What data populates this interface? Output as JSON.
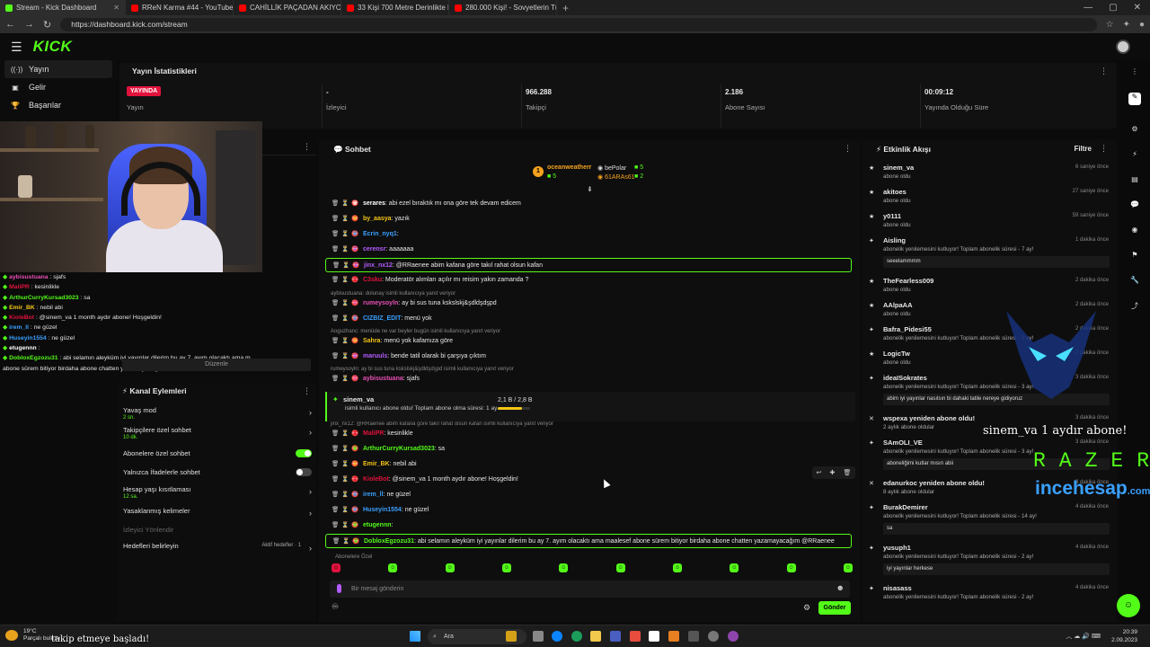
{
  "browser": {
    "tabs": [
      {
        "title": "Stream - Kick Dashboard",
        "active": true
      },
      {
        "title": "RReN Karma #44 - YouTube",
        "active": false
      },
      {
        "title": "CAHİLLİK PAÇADAN AKIYOR | 55...",
        "active": false
      },
      {
        "title": "33 Kişi 700 Metre Derinlikte Nasıl...",
        "active": false
      },
      {
        "title": "280.000 Kişi! - Sovyetlerin Tüm D...",
        "active": false
      }
    ],
    "url": "https://dashboard.kick.com/stream"
  },
  "app": {
    "logo": "KICK"
  },
  "nav": {
    "items": [
      {
        "label": "Yayın",
        "icon": "stream-icon"
      },
      {
        "label": "Gelir",
        "icon": "money-icon"
      },
      {
        "label": "Başarılar",
        "icon": "trophy-icon"
      }
    ]
  },
  "stats": {
    "title": "Yayın İstatistikleri",
    "items": [
      {
        "value": "YAYINDA",
        "label": "Yayın"
      },
      {
        "value": "-",
        "label": "İzleyici"
      },
      {
        "value": "966.288",
        "label": "Takipçi"
      },
      {
        "value": "2.186",
        "label": "Abone Sayısı"
      },
      {
        "value": "00:09:12",
        "label": "Yayında Olduğu Süre"
      }
    ]
  },
  "left_chat": [
    {
      "user": "aybisustuana",
      "text": " : sjafs",
      "color": "#e94fb5"
    },
    {
      "user": "MaliPR",
      "text": " : kesinlikle",
      "color": "#e1123c"
    },
    {
      "user": "ArthurCurryKursad3023",
      "text": " : sa",
      "color": "#53fc18"
    },
    {
      "user": "Emir_BK",
      "text": " : nebil abi",
      "color": "#f5c518"
    },
    {
      "user": "KioleBot",
      "text": " : @sinem_va 1 month aydır abone! Hoşgeldin!",
      "color": "#e1123c"
    },
    {
      "user": "irem_ll",
      "text": " : ne güzel",
      "color": "#3aa0ff"
    },
    {
      "user": "Huseyin1554",
      "text": " : ne güzel",
      "color": "#3aa0ff"
    },
    {
      "user": "etugennn",
      "text": " : ",
      "color": "#ffffff"
    },
    {
      "user": "DobloxEgzozu31",
      "text": " : abi selamın aleyküm iyi yayınlar dilerim bu ay 7. ayım olacaktı ama m",
      "color": "#53fc18"
    },
    {
      "user": "",
      "text": "abone sürem bitiyor birdaha abone chatten yazamayacağım @RRaenee",
      "color": "#ffffff"
    }
  ],
  "edit_button": "Düzenle",
  "channel_actions": {
    "title": "Kanal Eylemleri",
    "items": [
      {
        "label": "Yavaş mod",
        "sub": "2 sn.",
        "control": "chevron"
      },
      {
        "label": "Takipçilere özel sohbet",
        "sub": "10 dk.",
        "control": "chevron"
      },
      {
        "label": "Abonelere özel sohbet",
        "sub": "",
        "control": "toggle-on"
      },
      {
        "label": "Yalnızca İfadelerle sohbet",
        "sub": "",
        "control": "toggle-off"
      },
      {
        "label": "Hesap yaşı kısıtlaması",
        "sub": "12 sa.",
        "control": "chevron"
      },
      {
        "label": "Yasaklanmış kelimeler",
        "sub": "",
        "control": "chevron"
      },
      {
        "label": "İzleyici Yönlendir",
        "sub": "",
        "control": "none"
      },
      {
        "label": "Hedefleri belirleyin",
        "sub": "",
        "control": "chevron"
      }
    ],
    "goals_badge": "Aktif hedefler · 1"
  },
  "chat": {
    "title": "Sohbet",
    "pinned": {
      "top_user": "oceanweatherr",
      "top_count": "5",
      "rank": "1",
      "user2": "bePolar",
      "user2_count": "5",
      "user3": "61ARAs61",
      "user3_count": "2"
    },
    "messages": [
      {
        "user": "serares",
        "text": ": abi ezel bıraktık mı ona göre tek devam edicem",
        "color": "#ffffff",
        "hl": false
      },
      {
        "user": "by_aasya",
        "text": ": yazık",
        "color": "#f5c518",
        "hl": false
      },
      {
        "user": "Ecrin_nyq1",
        "text": ":",
        "color": "#3aa0ff",
        "hl": false
      },
      {
        "user": "cerensr",
        "text": ": aaaaaaa",
        "color": "#b35cff",
        "hl": false
      },
      {
        "user": "jinx_nx12",
        "text": ": @RRaenee abim kafana göre takıl rahat olsun kafan",
        "color": "#b35cff",
        "hl": true
      },
      {
        "user": "C3sku",
        "text": ": Moderatör alımları açılır mı reisim yakın zamanda ?",
        "color": "#e1123c",
        "hl": false
      },
      {
        "user": "rumeysoyln",
        "text": ": ay bi sus tuna kskslskj&şdldşdşpd",
        "color": "#e94fb5",
        "hl": false
      },
      {
        "user": "CIZBIZ_EDIT",
        "text": ": menü yok",
        "color": "#3aa0ff",
        "hl": false
      },
      {
        "user": "Sahra",
        "text": ": menü yok kafamıza göre",
        "color": "#f5c518",
        "hl": false
      },
      {
        "user": "maruuls",
        "text": ": bende tatil olarak bi çarşıya çıktım",
        "color": "#b35cff",
        "hl": false
      },
      {
        "user": "aybisustuana",
        "text": ": sjafs",
        "color": "#e94fb5",
        "hl": false
      },
      {
        "user": "MaliPR",
        "text": ": kesinlikle",
        "color": "#e1123c",
        "hl": false
      },
      {
        "user": "ArthurCurryKursad3023",
        "text": ": sa",
        "color": "#53fc18",
        "hl": false
      },
      {
        "user": "Emir_BK",
        "text": ": nebil abi",
        "color": "#f5c518",
        "hl": false
      },
      {
        "user": "KioleBot",
        "text": ": @sinem_va 1 month aydır abone! Hoşgeldin!",
        "color": "#e1123c",
        "hl": false
      },
      {
        "user": "irem_ll",
        "text": ": ne güzel",
        "color": "#3aa0ff",
        "hl": false
      },
      {
        "user": "Huseyin1554",
        "text": ": ne güzel",
        "color": "#3aa0ff",
        "hl": false
      },
      {
        "user": "etugennn",
        "text": ":",
        "color": "#53fc18",
        "hl": false
      },
      {
        "user": "DobloxEgzozu31",
        "text": ": abi selamın aleyküm iyi yayınlar dilerim bu ay 7. ayım olacaktı ama maalesef abone sürem bitiyor birdaha abone chatten yazamayacağım @RRaenee",
        "color": "#53fc18",
        "hl": true
      }
    ],
    "replies": [
      "aybisustuana: dolunay isimli kullanıcıya yanıt veriyor",
      "Aoguzhanc: menüde ne var beyler bugün isimli kullanıcıya yanıt veriyor",
      "rumeysoyln: ay bi sus tuna kskslskj&şdldşdşpd isimli kullanıcıya yanıt veriyor",
      "jinx_nx12: @RRaenee abim kafana göre takıl rahat olsun kafan isimli kullanıcıya yanıt veriyor"
    ],
    "sub_notice": {
      "user": "sinem_va",
      "text": "isimli kullanıcı abone oldu! Toplam abone olma süresi: 1 ay.",
      "amount": "2,1 B / 2,8 B",
      "progress": 0.75
    },
    "emote_section": "Abonelere Özel",
    "input_placeholder": "Bir mesaj gönderin",
    "send_label": "Gönder"
  },
  "feed": {
    "title": "Etkinlik Akışı",
    "filter": "Filtre",
    "events": [
      {
        "user": "sinem_va",
        "desc": "abone oldu",
        "time": "6 saniye önce",
        "msg": "",
        "type": "sub"
      },
      {
        "user": "akitoes",
        "desc": "abone oldu",
        "time": "27 saniye önce",
        "msg": "",
        "type": "sub"
      },
      {
        "user": "y0111",
        "desc": "abone oldu",
        "time": "59 saniye önce",
        "msg": "",
        "type": "sub"
      },
      {
        "user": "Aisling",
        "desc": "abonelik yenilemesini kutluyor! Toplam abonelik süresi - 7 ay!",
        "time": "1 dakika önce",
        "msg": "seeelammmm",
        "type": "resub"
      },
      {
        "user": "TheFearless009",
        "desc": "abone oldu",
        "time": "2 dakika önce",
        "msg": "",
        "type": "sub"
      },
      {
        "user": "AAlpaAA",
        "desc": "abone oldu",
        "time": "2 dakika önce",
        "msg": "",
        "type": "sub"
      },
      {
        "user": "Bafra_Pidesi55",
        "desc": "abonelik yenilemesini kutluyor! Toplam abonelik süresi - 2 ay!",
        "time": "2 dakika önce",
        "msg": "",
        "type": "resub"
      },
      {
        "user": "LogicTw",
        "desc": "abone oldu",
        "time": "2 dakika önce",
        "msg": "",
        "type": "sub"
      },
      {
        "user": "ideaISokrates",
        "desc": "abonelik yenilemesini kutluyor! Toplam abonelik süresi - 3 ay!",
        "time": "3 dakika önce",
        "msg": "abim iyi yayınlar nasılsın bi dahaki tatile nereye gidiyoruz",
        "type": "resub"
      },
      {
        "user": "wspexa yeniden abone oldu!",
        "desc": "2 aylık abone oldular",
        "time": "3 dakika önce",
        "msg": "",
        "type": "gift"
      },
      {
        "user": "SAmOLI_VE",
        "desc": "abonelik yenilemesini kutluyor! Toplam abonelik süresi - 3 ay!",
        "time": "3 dakika önce",
        "msg": "aboneliğimi kutlar mısın abii",
        "type": "resub"
      },
      {
        "user": "edanurkoc yeniden abone oldu!",
        "desc": "8 aylık abone oldular",
        "time": "3 dakika önce",
        "msg": "",
        "type": "gift"
      },
      {
        "user": "BurakDemirer",
        "desc": "abonelik yenilemesini kutluyor! Toplam abonelik süresi - 14 ay!",
        "time": "4 dakika önce",
        "msg": "sa",
        "type": "resub"
      },
      {
        "user": "yusuph1",
        "desc": "abonelik yenilemesini kutluyor! Toplam abonelik süresi - 2 ay!",
        "time": "4 dakika önce",
        "msg": "iyi yayınlar herkese",
        "type": "resub"
      },
      {
        "user": "nisasass",
        "desc": "abonelik yenilemesini kutluyor! Toplam abonelik süresi - 2 ay!",
        "time": "4 dakika önce",
        "msg": "",
        "type": "resub"
      }
    ]
  },
  "overlays": {
    "sub_alert": "sinem_va 1 aydır abone!",
    "sponsor1": "RAZER",
    "sponsor2": "incehesap",
    "sponsor2_tld": ".com",
    "follow_alert": "takip etmeye başladı!"
  },
  "taskbar": {
    "temp": "19°C",
    "weather_desc": "Parçalı bulutlu",
    "search": "Ara",
    "time": "20:39",
    "date": "2.09.2023"
  },
  "colors": {
    "accent": "#53fc18",
    "live": "#e1123c"
  }
}
